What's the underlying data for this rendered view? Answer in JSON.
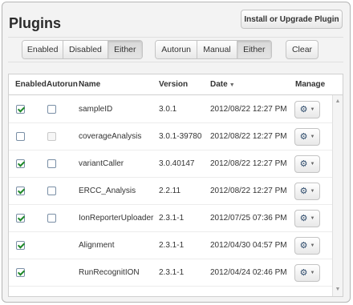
{
  "header": {
    "title": "Plugins",
    "install_label": "Install or Upgrade Plugin"
  },
  "filters": {
    "status": [
      "Enabled",
      "Disabled",
      "Either"
    ],
    "status_active": "Either",
    "mode": [
      "Autorun",
      "Manual",
      "Either"
    ],
    "mode_active": "Either",
    "clear_label": "Clear"
  },
  "table": {
    "columns": {
      "enabled": "Enabled",
      "autorun": "Autorun",
      "name": "Name",
      "version": "Version",
      "date": "Date",
      "manage": "Manage"
    },
    "sort_indicator": "▼",
    "rows": [
      {
        "enabled": true,
        "autorun": "unchecked",
        "name": "sampleID",
        "version": "3.0.1",
        "date": "2012/08/22 12:27 PM"
      },
      {
        "enabled": false,
        "autorun": "disabled",
        "name": "coverageAnalysis",
        "version": "3.0.1-39780",
        "date": "2012/08/22 12:27 PM"
      },
      {
        "enabled": true,
        "autorun": "unchecked",
        "name": "variantCaller",
        "version": "3.0.40147",
        "date": "2012/08/22 12:27 PM"
      },
      {
        "enabled": true,
        "autorun": "unchecked",
        "name": "ERCC_Analysis",
        "version": "2.2.11",
        "date": "2012/08/22 12:27 PM"
      },
      {
        "enabled": true,
        "autorun": "unchecked",
        "name": "IonReporterUploader",
        "version": "2.3.1-1",
        "date": "2012/07/25 07:36 PM"
      },
      {
        "enabled": true,
        "autorun": "none",
        "name": "Alignment",
        "version": "2.3.1-1",
        "date": "2012/04/30 04:57 PM"
      },
      {
        "enabled": true,
        "autorun": "none",
        "name": "RunRecognitION",
        "version": "2.3.1-1",
        "date": "2012/04/24 02:46 PM"
      }
    ]
  },
  "icons": {
    "gear": "gear-icon",
    "caret": "caret-down-icon",
    "check": "check-icon"
  },
  "colors": {
    "check": "#1f8a2a",
    "gear": "#2d4a6a"
  }
}
